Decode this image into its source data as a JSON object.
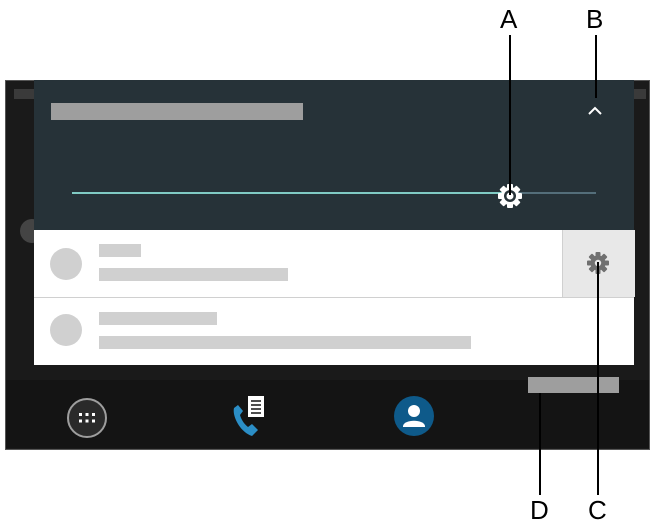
{
  "callouts": [
    {
      "letter": "A",
      "target": "brightness-slider"
    },
    {
      "letter": "B",
      "target": "collapse-button"
    },
    {
      "letter": "C",
      "target": "notification-settings-button"
    },
    {
      "letter": "D",
      "target": "grey-bar"
    }
  ],
  "brightness": {
    "level": 0.836
  },
  "notifications": [
    {
      "title": "",
      "text": "",
      "has_settings": true
    },
    {
      "title": "",
      "text": "",
      "has_settings": false
    }
  ],
  "navbar": {
    "items": [
      "apps-icon",
      "phone-log-icon",
      "contacts-icon"
    ]
  },
  "colors": {
    "shade": "#263238",
    "accent": "#80cbc4",
    "contacts": "#0e5a8a"
  }
}
